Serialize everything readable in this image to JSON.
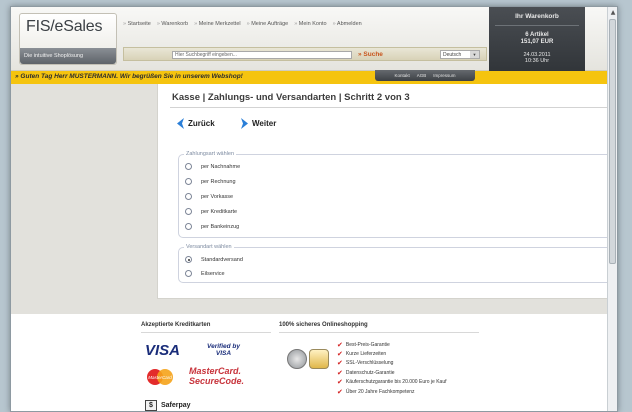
{
  "header": {
    "logo_brand": "FIS/eSales",
    "logo_slogan": "Die intuitive Shoplösung",
    "nav": [
      "Startseite",
      "Warenkorb",
      "Meine Merkzettel",
      "Meine Aufträge",
      "Mein Konto",
      "Abmelden"
    ],
    "search_placeholder": "Hier Suchbegriff eingeben...",
    "search_button": "» Suche",
    "language": "Deutsch",
    "subnav": [
      "Kontakt",
      "AGB",
      "Impressum"
    ],
    "greeting": "» Guten Tag Herr MUSTERMANN. Wir begrüßen Sie in unserem Webshop!"
  },
  "cart": {
    "title": "Ihr Warenkorb",
    "items": "6 Artikel",
    "sum": "151,07 EUR",
    "date": "24.03.2011",
    "time": "10:36 Uhr"
  },
  "checkout": {
    "title": "Kasse | Zahlungs- und Versandarten | Schritt 2 von 3",
    "back": "Zurück",
    "next": "Weiter",
    "payment_legend": "Zahlungsart wählen",
    "payment_options": [
      "per Nachnahme",
      "per Rechnung",
      "per Vorkasse",
      "per Kreditkarte",
      "per Bankeinzug"
    ],
    "shipping_legend": "Versandart wählen",
    "shipping_options": [
      "Standardversand",
      "Eilservice"
    ],
    "shipping_selected": "Standardversand"
  },
  "footer": {
    "cards_title": "Akzeptierte Kreditkarten",
    "visa": "VISA",
    "verified_by": "Verified by",
    "verified_visa": "VISA",
    "mc_logo": "MasterCard",
    "mc_securecode_1": "MasterCard.",
    "mc_securecode_2": "SecureCode.",
    "safepay": "Saferpay",
    "trust_title": "100% sicheres Onlineshopping",
    "trust_items": [
      "Best-Preis-Garantie",
      "Kurze Lieferzeiten",
      "SSL-Verschlüsselung",
      "Datenschutz-Garantie",
      "Käuferschutzgarantie bis 20.000 Euro je Kauf",
      "Über 20 Jahre Fachkompetenz"
    ]
  },
  "colors": {
    "accent_yellow": "#f5c40f",
    "search_orange": "#c8541c",
    "check_red": "#d32222",
    "arrow_blue": "#2b7fd8"
  }
}
